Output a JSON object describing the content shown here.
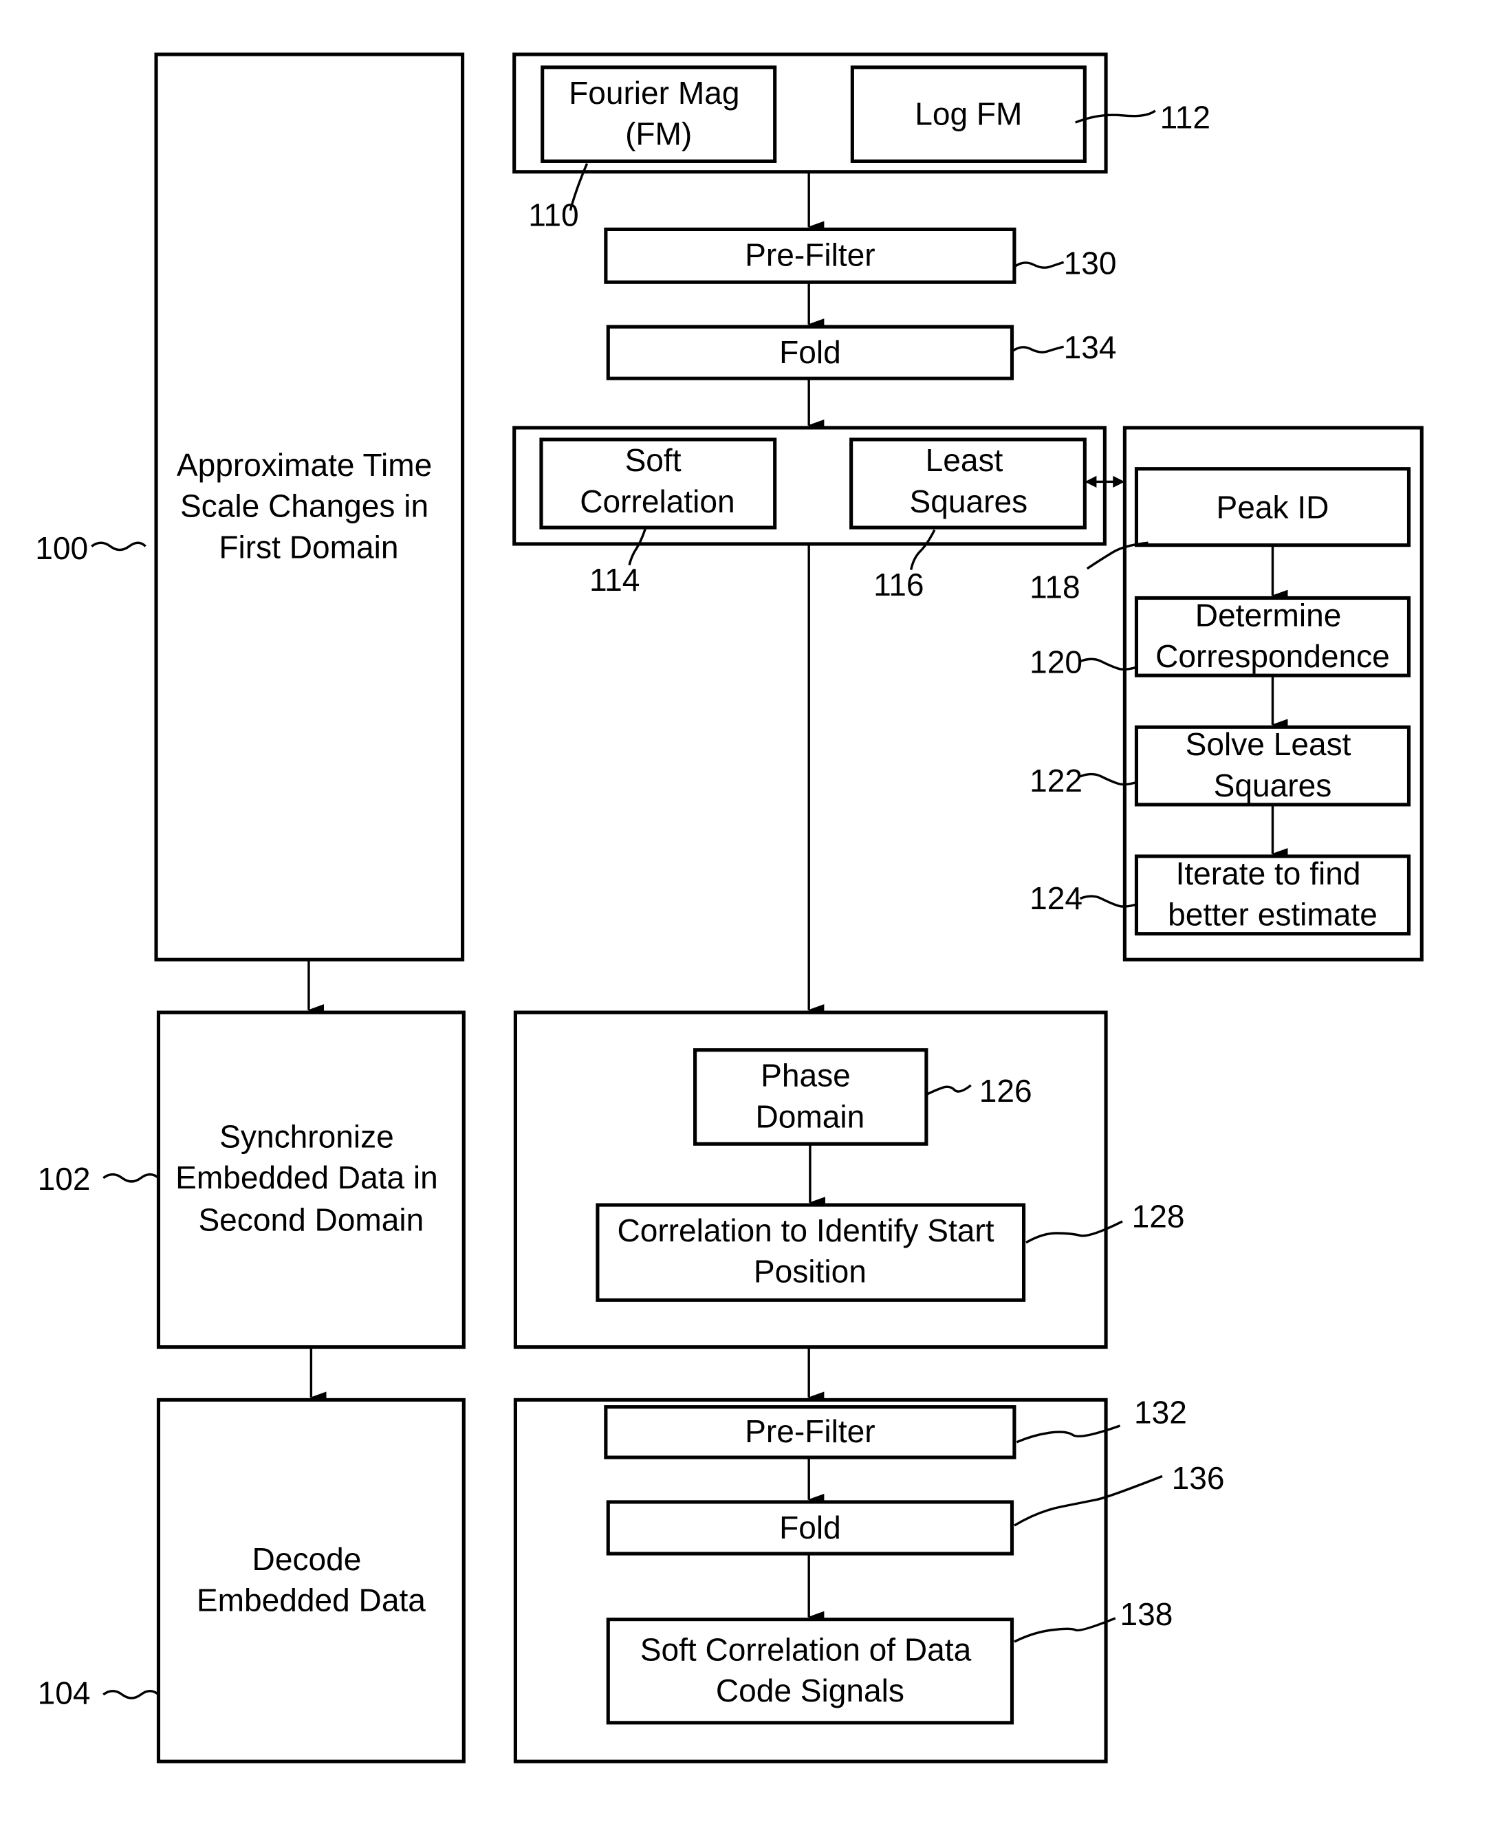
{
  "diagram": {
    "left_steps": [
      {
        "id": "100",
        "lines": [
          "Approximate Time",
          "Scale Changes in",
          "First Domain"
        ]
      },
      {
        "id": "102",
        "lines": [
          "Synchronize",
          "Embedded Data in",
          "Second Domain"
        ]
      },
      {
        "id": "104",
        "lines": [
          "Decode",
          "Embedded Data"
        ]
      }
    ],
    "blocks": {
      "fourier_mag": {
        "id": "110",
        "lines": [
          "Fourier Mag",
          "(FM)"
        ]
      },
      "log_fm": {
        "id": "112",
        "lines": [
          "Log FM"
        ]
      },
      "prefilter_1": {
        "id": "130",
        "lines": [
          "Pre-Filter"
        ]
      },
      "fold_1": {
        "id": "134",
        "lines": [
          "Fold"
        ]
      },
      "soft_correlation": {
        "id": "114",
        "lines": [
          "Soft",
          "Correlation"
        ]
      },
      "least_squares": {
        "id": "116",
        "lines": [
          "Least",
          "Squares"
        ]
      },
      "peak_id": {
        "id": "118",
        "lines": [
          "Peak ID"
        ]
      },
      "determine_correspondence": {
        "id": "120",
        "lines": [
          "Determine",
          "Correspondence"
        ]
      },
      "solve_least_squares": {
        "id": "122",
        "lines": [
          "Solve Least",
          "Squares"
        ]
      },
      "iterate": {
        "id": "124",
        "lines": [
          "Iterate to find",
          "better estimate"
        ]
      },
      "phase_domain": {
        "id": "126",
        "lines": [
          "Phase",
          "Domain"
        ]
      },
      "correlation_start": {
        "id": "128",
        "lines": [
          "Correlation to Identify Start",
          "Position"
        ]
      },
      "prefilter_2": {
        "id": "132",
        "lines": [
          "Pre-Filter"
        ]
      },
      "fold_2": {
        "id": "136",
        "lines": [
          "Fold"
        ]
      },
      "soft_correlation_data": {
        "id": "138",
        "lines": [
          "Soft Correlation of Data",
          "Code Signals"
        ]
      }
    }
  }
}
